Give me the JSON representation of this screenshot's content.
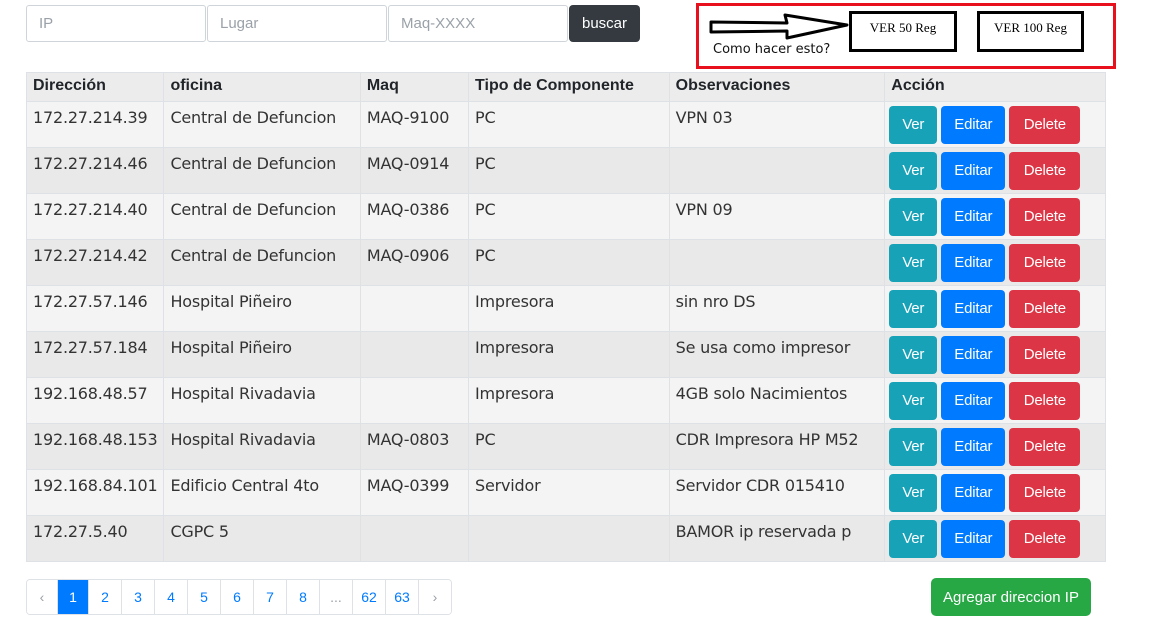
{
  "search": {
    "ip_placeholder": "IP",
    "lugar_placeholder": "Lugar",
    "maq_placeholder": "Maq-XXXX",
    "button_label": "buscar"
  },
  "annotation": {
    "text": "Como hacer esto?",
    "btn_50": "VER 50 Reg",
    "btn_100": "VER 100 Reg",
    "border_color": "#e8101d"
  },
  "table": {
    "headers": [
      "Dirección",
      "oficina",
      "Maq",
      "Tipo de Componente",
      "Observaciones",
      "Acción"
    ],
    "action_labels": {
      "ver": "Ver",
      "editar": "Editar",
      "delete": "Delete"
    },
    "rows": [
      [
        "172.27.214.39",
        "Central de Defuncion",
        "MAQ-9100",
        "PC",
        "VPN 03"
      ],
      [
        "172.27.214.46",
        "Central de Defuncion",
        "MAQ-0914",
        "PC",
        ""
      ],
      [
        "172.27.214.40",
        "Central de Defuncion",
        "MAQ-0386",
        "PC",
        "VPN 09"
      ],
      [
        "172.27.214.42",
        "Central de Defuncion",
        "MAQ-0906",
        "PC",
        ""
      ],
      [
        "172.27.57.146",
        "Hospital Piñeiro",
        "",
        "Impresora",
        "sin nro DS"
      ],
      [
        "172.27.57.184",
        "Hospital Piñeiro",
        "",
        "Impresora",
        "Se usa como impresor"
      ],
      [
        "192.168.48.57",
        "Hospital Rivadavia",
        "",
        "Impresora",
        "4GB solo Nacimientos"
      ],
      [
        "192.168.48.153",
        "Hospital Rivadavia",
        "MAQ-0803",
        "PC",
        "CDR Impresora HP M52"
      ],
      [
        "192.168.84.101",
        "Edificio Central 4to",
        "MAQ-0399",
        "Servidor",
        "Servidor CDR 015410"
      ],
      [
        "172.27.5.40",
        "CGPC 5",
        "",
        "",
        "BAMOR ip reservada p"
      ]
    ]
  },
  "pagination": {
    "items": [
      "‹",
      "1",
      "2",
      "3",
      "4",
      "5",
      "6",
      "7",
      "8",
      "...",
      "62",
      "63",
      "›"
    ],
    "active": "1"
  },
  "add_button": "Agregar direccion IP",
  "colors": {
    "ver": "#17a2b8",
    "editar": "#007bff",
    "delete": "#dc3545",
    "add": "#28a745",
    "buscar": "#343a40"
  }
}
